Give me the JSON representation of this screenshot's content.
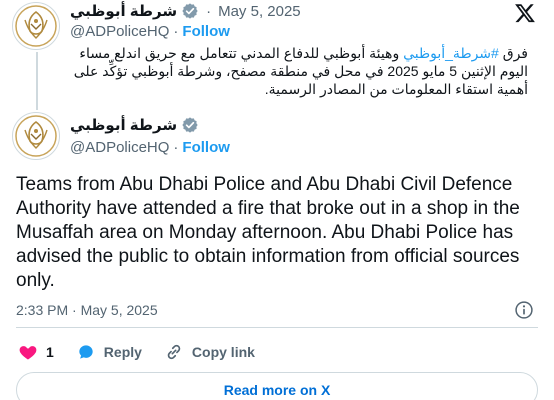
{
  "parent_tweet": {
    "display_name": "شرطة أبوظبي",
    "handle": "@ADPoliceHQ",
    "follow_label": "Follow",
    "date": "May 5, 2025",
    "date_separator": "·",
    "text_hashtag": "#شرطة_أبوظبي",
    "text_prefix": "فرق",
    "text_rest": "وهيئة أبوظبي للدفاع المدني تتعامل مع حريق اندلع مساء اليوم الإثنين 5 مايو 2025 في محل في منطقة مصفح، وشرطة أبوظبي تؤكِّد على أهمية استقاء المعلومات من المصادر الرسمية."
  },
  "main_tweet": {
    "display_name": "شرطة أبوظبي",
    "handle": "@ADPoliceHQ",
    "follow_label": "Follow",
    "text": "Teams from Abu Dhabi Police and Abu Dhabi Civil Defence Authority have attended a fire that broke out in a shop in the Musaffah area on Monday afternoon. Abu Dhabi Police has advised the public to obtain information from official sources only.",
    "timestamp": "2:33 PM · May 5, 2025",
    "like_count": "1",
    "reply_label": "Reply",
    "copy_link_label": "Copy link",
    "read_more_label": "Read more on X"
  },
  "colors": {
    "accent": "#1d9bf0",
    "like": "#f91880",
    "muted": "#536471"
  },
  "icons": [
    "police-logo-avatar",
    "verified-badge-icon",
    "x-logo-icon",
    "info-icon",
    "heart-icon",
    "reply-bubble-icon",
    "link-icon"
  ]
}
